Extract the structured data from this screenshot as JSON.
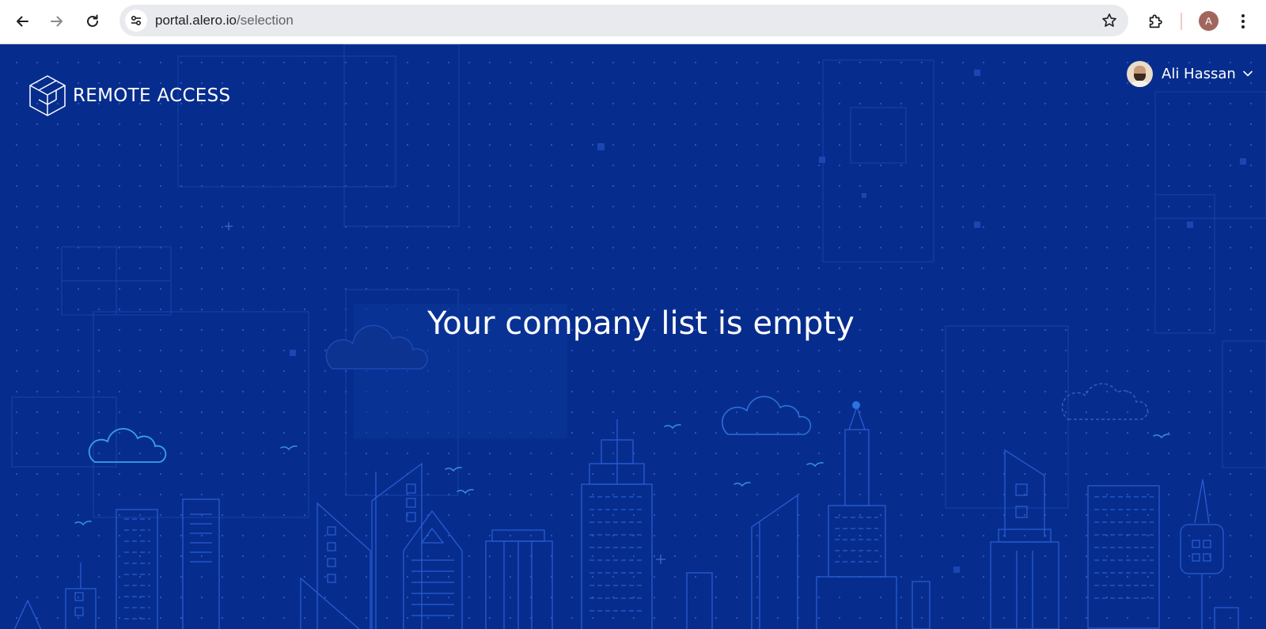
{
  "browser": {
    "url_host": "portal.alero.io",
    "url_path": "/selection",
    "profile_initial": "A"
  },
  "brand": {
    "name": "REMOTE ACCESS"
  },
  "user": {
    "name": "Ali Hassan"
  },
  "main": {
    "empty_message": "Your company list is empty"
  },
  "colors": {
    "page_background": "#062d8d",
    "line_art": "#2a5bd1",
    "cloud_accent": "#3aa0e8"
  },
  "icons": {
    "back": "arrow-left-icon",
    "forward": "arrow-right-icon",
    "reload": "reload-icon",
    "site_info": "tune-icon",
    "bookmark": "star-icon",
    "extensions": "puzzle-icon",
    "menu": "kebab-icon",
    "logo": "cube-icon",
    "dropdown": "chevron-down-icon"
  }
}
